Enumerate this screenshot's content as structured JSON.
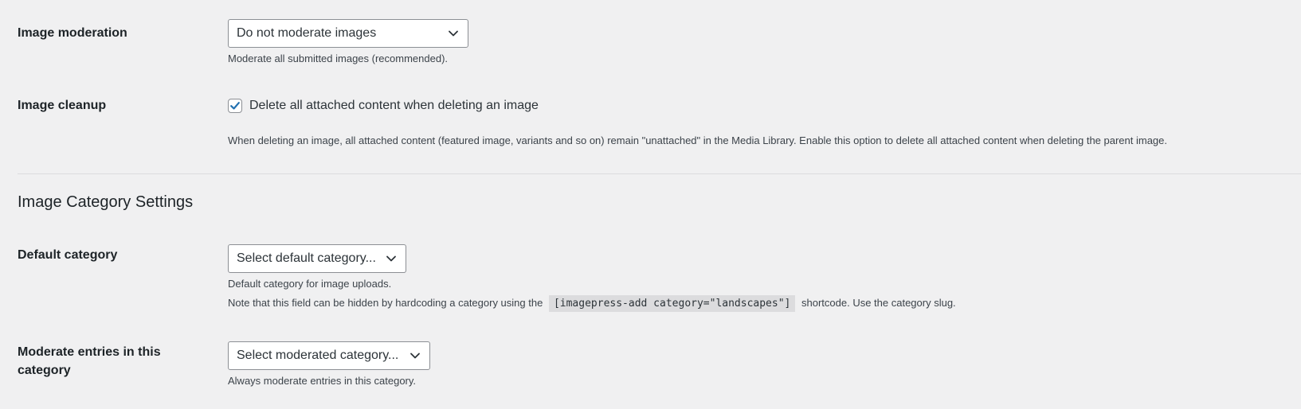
{
  "image_moderation": {
    "label": "Image moderation",
    "selected": "Do not moderate images",
    "description": "Moderate all submitted images (recommended)."
  },
  "image_cleanup": {
    "label": "Image cleanup",
    "checkbox_label": "Delete all attached content when deleting an image",
    "checked": true,
    "description": "When deleting an image, all attached content (featured image, variants and so on) remain \"unattached\" in the Media Library. Enable this option to delete all attached content when deleting the parent image."
  },
  "category_section": {
    "title": "Image Category Settings"
  },
  "default_category": {
    "label": "Default category",
    "selected": "Select default category...",
    "description": "Default category for image uploads.",
    "note_before": "Note that this field can be hidden by hardcoding a category using the",
    "shortcode": "[imagepress-add category=\"landscapes\"]",
    "note_after": "shortcode. Use the category slug."
  },
  "moderated_category": {
    "label": "Moderate entries in this category",
    "selected": "Select moderated category...",
    "description": "Always moderate entries in this category."
  },
  "colors": {
    "background": "#f0f0f1",
    "text": "#1d2327",
    "accent": "#2271b1",
    "border": "#8c8f94"
  },
  "icons": {
    "select_arrow": "chevron-down-icon",
    "checkmark": "checkmark-icon"
  }
}
